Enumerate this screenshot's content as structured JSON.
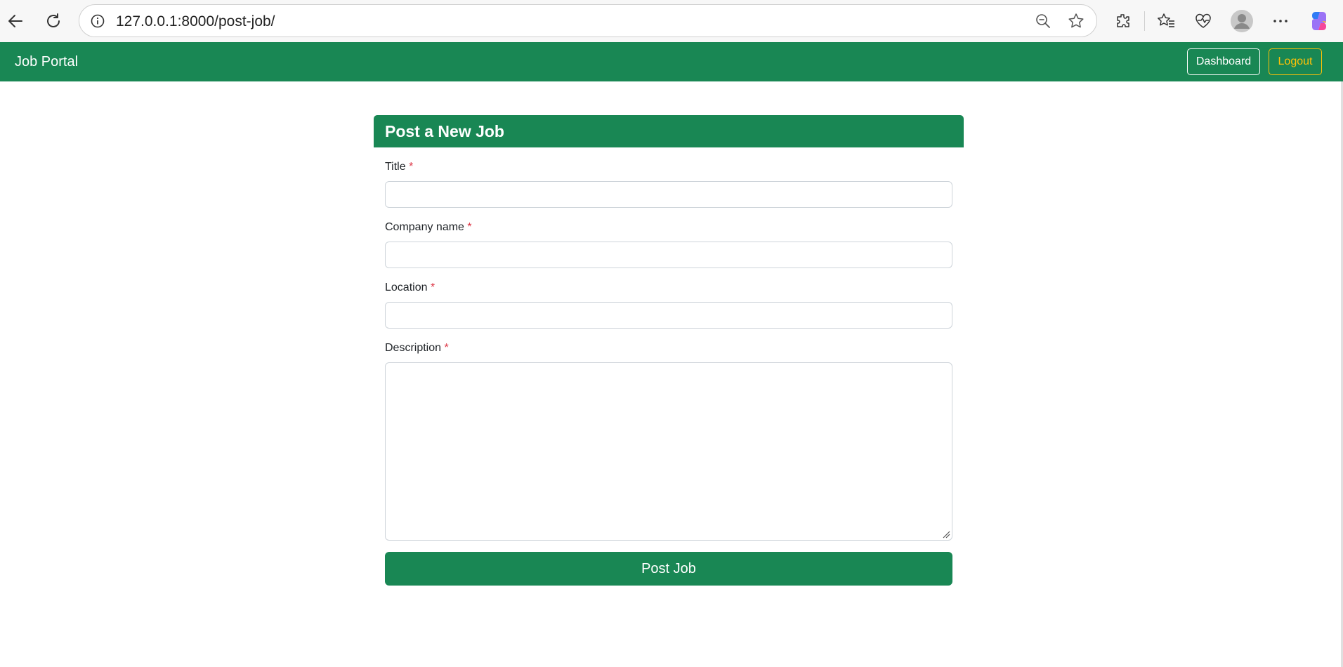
{
  "browser": {
    "url": "127.0.0.1:8000/post-job/",
    "icons": [
      "back-arrow-icon",
      "reload-icon",
      "site-info-icon",
      "zoom-out-icon",
      "favorite-star-icon",
      "extensions-icon",
      "favorites-icon",
      "browser-essentials-icon",
      "profile-avatar-icon",
      "more-menu-icon",
      "copilot-icon"
    ]
  },
  "navbar": {
    "brand": "Job Portal",
    "dashboard_label": "Dashboard",
    "logout_label": "Logout"
  },
  "form": {
    "heading": "Post a New Job",
    "fields": {
      "title": {
        "label": "Title",
        "required_mark": "*",
        "value": ""
      },
      "company": {
        "label": "Company name",
        "required_mark": "*",
        "value": ""
      },
      "location": {
        "label": "Location",
        "required_mark": "*",
        "value": ""
      },
      "description": {
        "label": "Description",
        "required_mark": "*",
        "value": ""
      }
    },
    "submit_label": "Post Job"
  },
  "colors": {
    "primary": "#198754",
    "warning": "#ffc107",
    "danger": "#dc3545"
  }
}
